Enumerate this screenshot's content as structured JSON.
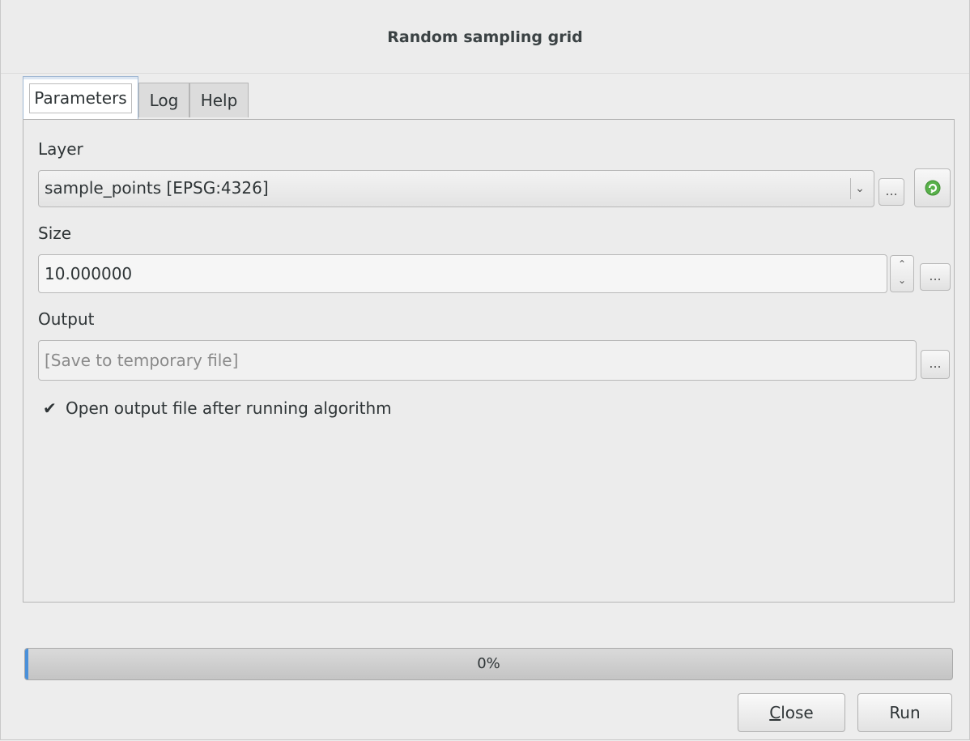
{
  "window": {
    "title": "Random sampling grid"
  },
  "tabs": [
    {
      "label": "Parameters",
      "active": true
    },
    {
      "label": "Log",
      "active": false
    },
    {
      "label": "Help",
      "active": false
    }
  ],
  "parameters": {
    "layer": {
      "label": "Layer",
      "value": "sample_points [EPSG:4326]"
    },
    "size": {
      "label": "Size",
      "value": "10.000000"
    },
    "output": {
      "label": "Output",
      "placeholder": "[Save to temporary file]"
    },
    "open_output": {
      "label": "Open output file after running algorithm",
      "checked": true
    },
    "browse_label": "..."
  },
  "progress": {
    "text": "0%",
    "value": 0
  },
  "buttons": {
    "close_first": "C",
    "close_rest": "lose",
    "run": "Run"
  },
  "colors": {
    "accent": "#4a90d9",
    "iterate_icon": "#4caf50"
  },
  "icons": {
    "iterate": "iterate-icon",
    "check": "checkbox-check-icon"
  }
}
